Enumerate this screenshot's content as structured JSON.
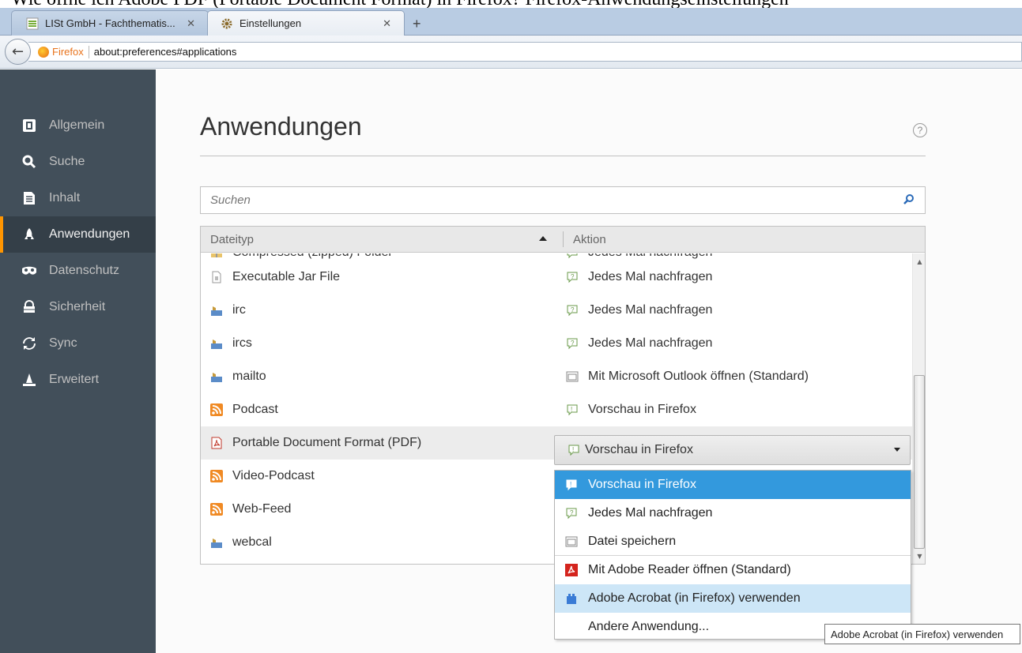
{
  "top_text": "Wie öffne ich Adobe PDF (Portable Document Format) in Firefox? Firefox-Anwendungseinstellungen",
  "tabs": [
    {
      "label": "LISt GmbH - Fachthematis...",
      "icon": "list-logo-icon"
    },
    {
      "label": "Einstellungen",
      "icon": "gear-icon"
    }
  ],
  "navbar": {
    "browser_name": "Firefox",
    "url": "about:preferences#applications"
  },
  "sidebar": {
    "items": [
      {
        "label": "Allgemein",
        "icon": "general-icon"
      },
      {
        "label": "Suche",
        "icon": "search-icon"
      },
      {
        "label": "Inhalt",
        "icon": "document-icon"
      },
      {
        "label": "Anwendungen",
        "icon": "rocket-icon",
        "active": true
      },
      {
        "label": "Datenschutz",
        "icon": "mask-icon"
      },
      {
        "label": "Sicherheit",
        "icon": "lock-icon"
      },
      {
        "label": "Sync",
        "icon": "sync-icon"
      },
      {
        "label": "Erweitert",
        "icon": "wizard-hat-icon"
      }
    ]
  },
  "main": {
    "title": "Anwendungen",
    "help": "?",
    "search": {
      "placeholder": "Suchen",
      "value": ""
    },
    "table": {
      "col_type": "Dateityp",
      "col_action": "Aktion",
      "rows": [
        {
          "type": "Compressed (zipped) Folder",
          "action": "Jedes Mal nachfragen"
        },
        {
          "type": "Executable Jar File",
          "action": "Jedes Mal nachfragen"
        },
        {
          "type": "irc",
          "action": "Jedes Mal nachfragen"
        },
        {
          "type": "ircs",
          "action": "Jedes Mal nachfragen"
        },
        {
          "type": "mailto",
          "action": "Mit Microsoft Outlook öffnen (Standard)"
        },
        {
          "type": "Podcast",
          "action": "Vorschau in Firefox"
        },
        {
          "type": "Portable Document Format (PDF)",
          "action": "Vorschau in Firefox"
        },
        {
          "type": "Video-Podcast",
          "action": ""
        },
        {
          "type": "Web-Feed",
          "action": ""
        },
        {
          "type": "webcal",
          "action": ""
        }
      ]
    },
    "dropdown_options": [
      {
        "label": "Vorschau in Firefox",
        "icon": "preview-icon"
      },
      {
        "label": "Jedes Mal nachfragen",
        "icon": "ask-icon"
      },
      {
        "label": "Datei speichern",
        "icon": "save-icon"
      },
      {
        "label": "Mit Adobe Reader  öffnen (Standard)",
        "icon": "adobe-reader-icon"
      },
      {
        "label": "Adobe Acrobat (in Firefox) verwenden",
        "icon": "plugin-icon"
      },
      {
        "label": "Andere Anwendung...",
        "icon": ""
      }
    ]
  },
  "tooltip": "Adobe Acrobat (in Firefox) verwenden"
}
